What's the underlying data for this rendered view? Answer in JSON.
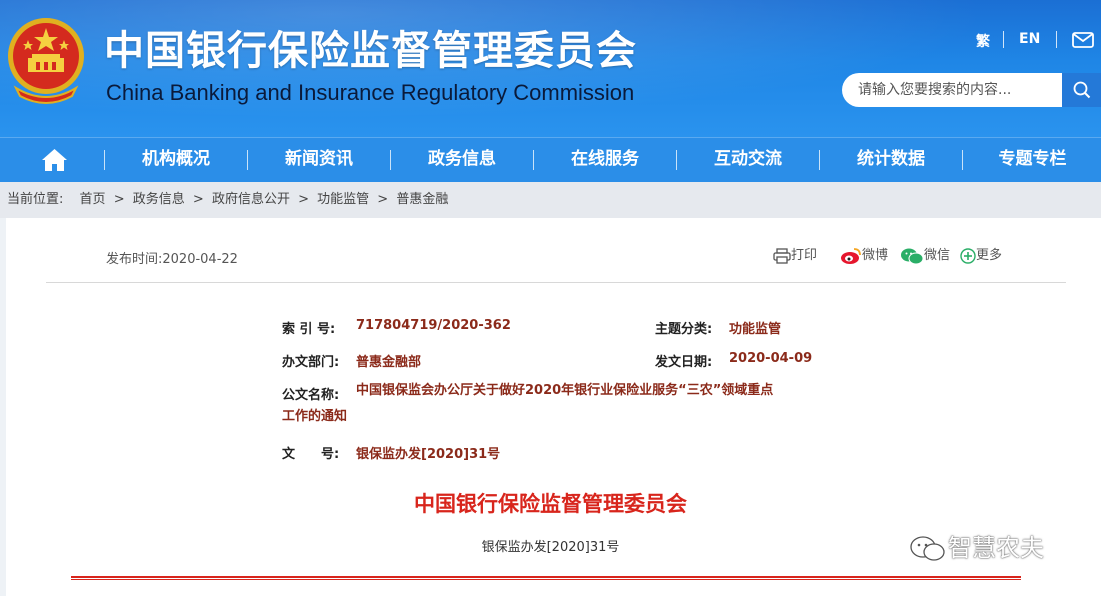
{
  "header": {
    "title_cn": "中国银行保险监督管理委员会",
    "title_en": "China Banking and Insurance Regulatory Commission",
    "lang_traditional": "繁",
    "lang_english": "EN",
    "search_placeholder": "请输入您要搜索的内容..."
  },
  "nav": {
    "items": [
      "机构概况",
      "新闻资讯",
      "政务信息",
      "在线服务",
      "互动交流",
      "统计数据",
      "专题专栏"
    ]
  },
  "breadcrumb": {
    "label": "当前位置:",
    "items": [
      "首页",
      "政务信息",
      "政府信息公开",
      "功能监管",
      "普惠金融"
    ],
    "separator": ">"
  },
  "article": {
    "publish_time": "发布时间:2020-04-22",
    "share": {
      "print": "打印",
      "weibo": "微博",
      "wechat": "微信",
      "more": "更多"
    },
    "meta": {
      "index_label": "索 引 号:",
      "index_value": "717804719/2020-362",
      "topic_label": "主题分类:",
      "topic_value": "功能监管",
      "dept_label": "办文部门:",
      "dept_value": "普惠金融部",
      "date_label": "发文日期:",
      "date_value": "2020-04-09",
      "name_label": "公文名称:",
      "name_value": "中国银保监会办公厅关于做好2020年银行业保险业服务“三农”领域重点工作的通知",
      "docno_label": "文　　号:",
      "docno_value": "银保监办发[2020]31号"
    },
    "doc_title": "中国银行保险监督管理委员会",
    "doc_number": "银保监办发[2020]31号"
  },
  "watermark": {
    "text": "智慧农夫"
  },
  "colors": {
    "header_blue": "#1f86e6",
    "nav_blue": "#2b8ee8",
    "meta_value": "#8b2a1a",
    "doc_red": "#d8251c"
  }
}
